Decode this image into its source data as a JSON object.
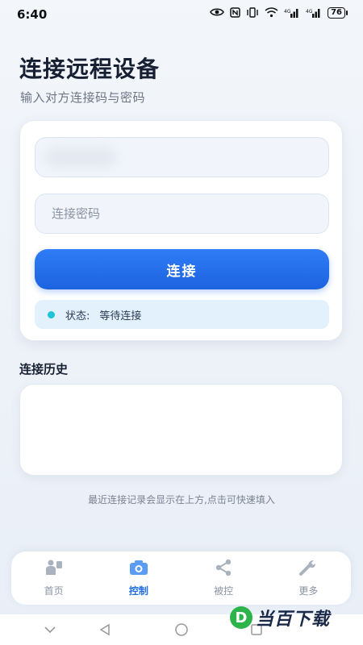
{
  "status_bar": {
    "time": "6:40",
    "battery": "76"
  },
  "header": {
    "title": "连接远程设备",
    "subtitle": "输入对方连接码与密码"
  },
  "connect_form": {
    "code_value": "",
    "password_placeholder": "连接密码",
    "connect_label": "连接",
    "status_label": "状态:",
    "status_value": "等待连接",
    "status_color": "#1ec3d8",
    "accent_color": "#1f6ee8"
  },
  "history": {
    "title": "连接历史",
    "hint": "最近连接记录会显示在上方,点击可快速填入"
  },
  "bottom_nav": {
    "items": [
      {
        "label": "首页",
        "icon": "home-icon"
      },
      {
        "label": "控制",
        "icon": "camera-icon",
        "active": true
      },
      {
        "label": "被控",
        "icon": "share-icon"
      },
      {
        "label": "更多",
        "icon": "wrench-icon"
      }
    ]
  },
  "watermark": {
    "badge": "D",
    "text": "当百下载"
  }
}
